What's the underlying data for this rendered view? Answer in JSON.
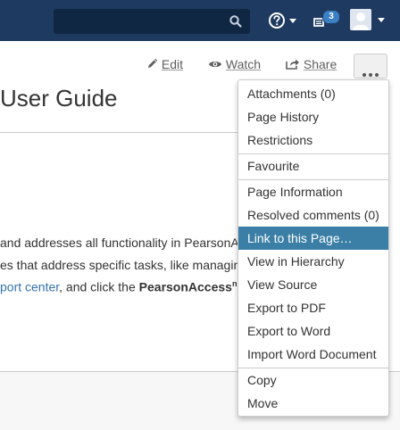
{
  "header": {
    "search_placeholder": "",
    "notification_count": "3",
    "icons": [
      "search-icon",
      "help-icon",
      "notifications-icon",
      "user-avatar-icon"
    ]
  },
  "toolbar": {
    "edit_label": "Edit",
    "watch_label": "Watch",
    "share_label": "Share"
  },
  "page": {
    "title": "User Guide",
    "lines": {
      "line1": " and addresses all functionality in PearsonA",
      "line2": "es that address specific tasks, like managin",
      "line3_link": "port center",
      "line3_text": ", and click the ",
      "line3_bold": "PearsonAccess",
      "line3_sup": "n"
    }
  },
  "menu": {
    "items": [
      {
        "label": "Attachments (0)",
        "accesskey_index": 1
      },
      {
        "label": "Page History"
      },
      {
        "label": "Restrictions"
      },
      {
        "label": "Favourite"
      },
      {
        "label": "Page Information"
      },
      {
        "label": "Resolved comments (0)"
      },
      {
        "label": "Link to this Page…",
        "active": true
      },
      {
        "label": "View in Hierarchy"
      },
      {
        "label": "View Source"
      },
      {
        "label": "Export to PDF"
      },
      {
        "label": "Export to Word"
      },
      {
        "label": "Import Word Document"
      },
      {
        "label": "Copy"
      },
      {
        "label": "Move"
      }
    ]
  },
  "colors": {
    "header_bg": "#1f3a60",
    "menu_active_bg": "#3b7fa6",
    "link": "#3572b0",
    "badge": "#3b7fc4"
  }
}
